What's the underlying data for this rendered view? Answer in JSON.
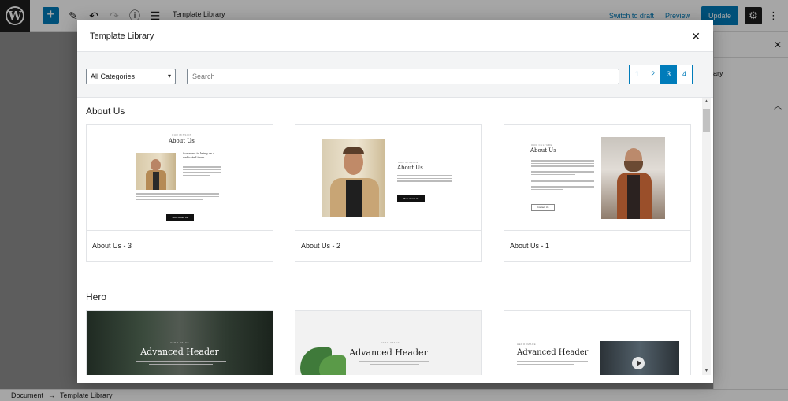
{
  "editor": {
    "post_title": "Template Library",
    "switch_to_draft": "Switch to draft",
    "preview": "Preview",
    "update": "Update",
    "sidebar_fragment": "ary",
    "breadcrumb": [
      "Document",
      "Template Library"
    ]
  },
  "modal": {
    "title": "Template Library",
    "category_select": "All Categories",
    "search_placeholder": "Search",
    "pages": [
      "1",
      "2",
      "3",
      "4"
    ],
    "active_page": "3"
  },
  "sections": [
    {
      "title": "About Us",
      "cards": [
        {
          "caption": "About Us - 3",
          "heading": "About Us",
          "kicker": "OUR MISSION",
          "button": "More About Us"
        },
        {
          "caption": "About Us - 2",
          "heading": "About Us",
          "kicker": "OUR MISSION",
          "button": "More About Us"
        },
        {
          "caption": "About Us - 1",
          "heading": "About Us",
          "kicker": "OUR CULTURE",
          "button": "Contact Us"
        }
      ]
    },
    {
      "title": "Hero",
      "cards": [
        {
          "heading": "Advanced Header",
          "kicker": "HERO IMAGE"
        },
        {
          "heading": "Advanced Header",
          "kicker": "HERO IMAGE"
        },
        {
          "heading": "Advanced Header",
          "kicker": "HERO IMAGE"
        }
      ]
    }
  ],
  "colors": {
    "accent": "#007cba",
    "dark": "#1e1e1e"
  }
}
